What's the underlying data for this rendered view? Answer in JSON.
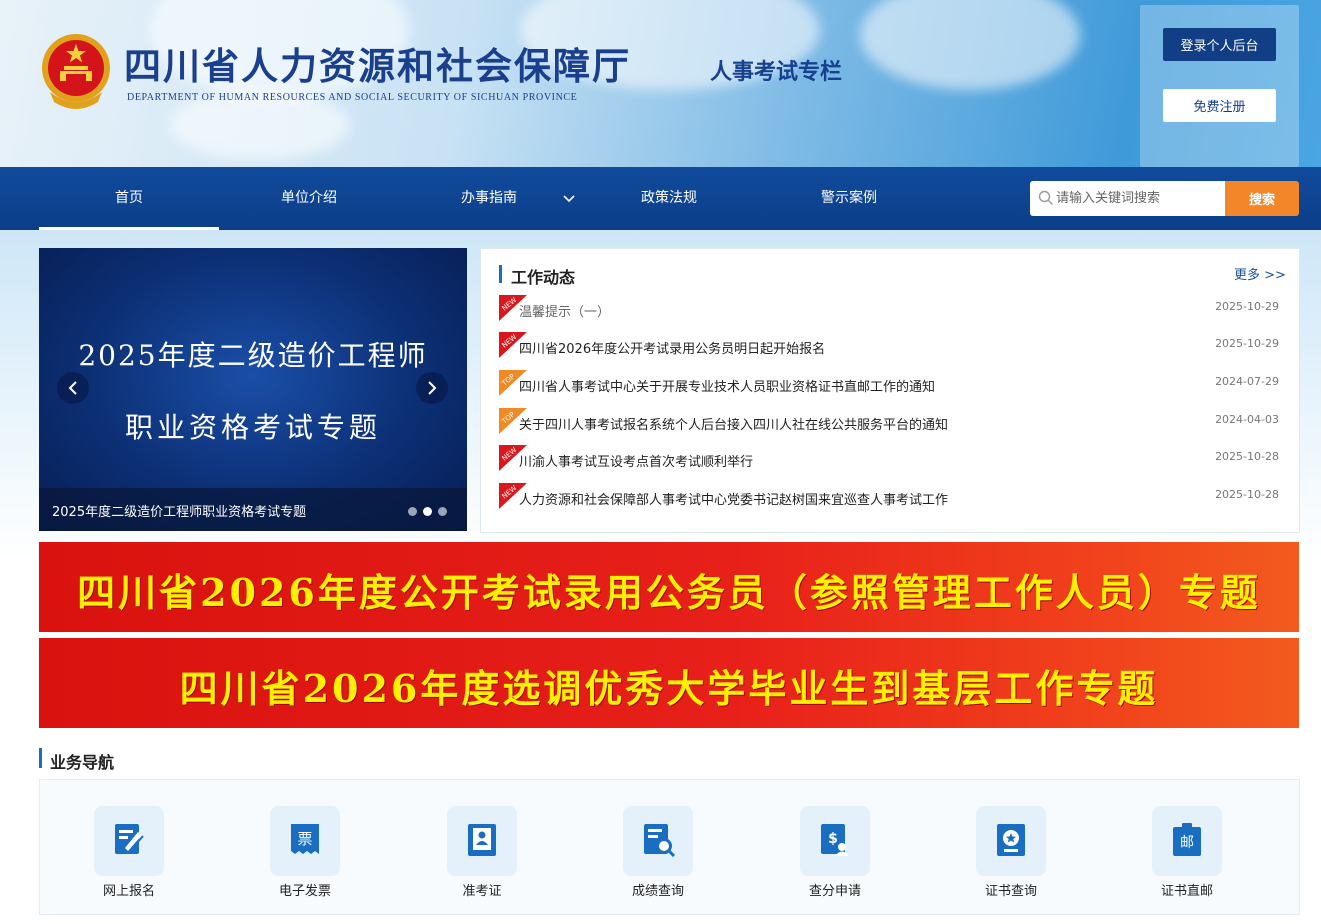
{
  "header": {
    "site_title": "四川省人力资源和社会保障厅",
    "site_subtitle": "DEPARTMENT OF HUMAN RESOURCES AND SOCIAL SECURITY OF SICHUAN PROVINCE",
    "column_title": "人事考试专栏",
    "login_label": "登录个人后台",
    "register_label": "免费注册"
  },
  "nav": {
    "items": [
      {
        "label": "首页"
      },
      {
        "label": "单位介绍"
      },
      {
        "label": "办事指南"
      },
      {
        "label": "政策法规"
      },
      {
        "label": "警示案例"
      }
    ],
    "search_placeholder": "请输入关键词搜索",
    "search_button": "搜索"
  },
  "slider": {
    "slide_line1": "2025年度二级造价工程师",
    "slide_line2": "职业资格考试专题",
    "caption": "2025年度二级造价工程师职业资格考试专题",
    "active_index": 1,
    "slide_count": 3
  },
  "news": {
    "title": "工作动态",
    "more": "更多 >>",
    "items": [
      {
        "badge": "NEW",
        "text": "温馨提示（一）",
        "date": "2025-10-29"
      },
      {
        "badge": "NEW",
        "text": "四川省2026年度公开考试录用公务员明日起开始报名",
        "date": "2025-10-29"
      },
      {
        "badge": "TOP",
        "text": "四川省人事考试中心关于开展专业技术人员职业资格证书直邮工作的通知",
        "date": "2024-07-29"
      },
      {
        "badge": "TOP",
        "text": "关于四川人事考试报名系统个人后台接入四川人社在线公共服务平台的通知",
        "date": "2024-04-03"
      },
      {
        "badge": "NEW",
        "text": "川渝人事考试互设考点首次考试顺利举行",
        "date": "2025-10-28"
      },
      {
        "badge": "NEW",
        "text": "人力资源和社会保障部人事考试中心党委书记赵树国来宜巡查人事考试工作",
        "date": "2025-10-28"
      }
    ]
  },
  "banners": [
    {
      "text": "四川省2026年度公开考试录用公务员（参照管理工作人员）专题"
    },
    {
      "text": "四川省2026年度选调优秀大学毕业生到基层工作专题"
    }
  ],
  "services": {
    "title": "业务导航",
    "items": [
      {
        "label": "网上报名",
        "icon": "signup-icon"
      },
      {
        "label": "电子发票",
        "icon": "invoice-icon",
        "glyph": "票"
      },
      {
        "label": "准考证",
        "icon": "admission-ticket-icon"
      },
      {
        "label": "成绩查询",
        "icon": "score-query-icon"
      },
      {
        "label": "查分申请",
        "icon": "score-review-icon"
      },
      {
        "label": "证书查询",
        "icon": "certificate-query-icon"
      },
      {
        "label": "证书直邮",
        "icon": "certificate-mail-icon",
        "glyph": "邮"
      }
    ]
  },
  "colors": {
    "nav_bg": "#0b3e88",
    "accent_orange": "#f4862a",
    "banner_red": "#e8201a",
    "banner_text": "#fff000",
    "badge_new": "#d9171c",
    "badge_top": "#f08a24"
  }
}
